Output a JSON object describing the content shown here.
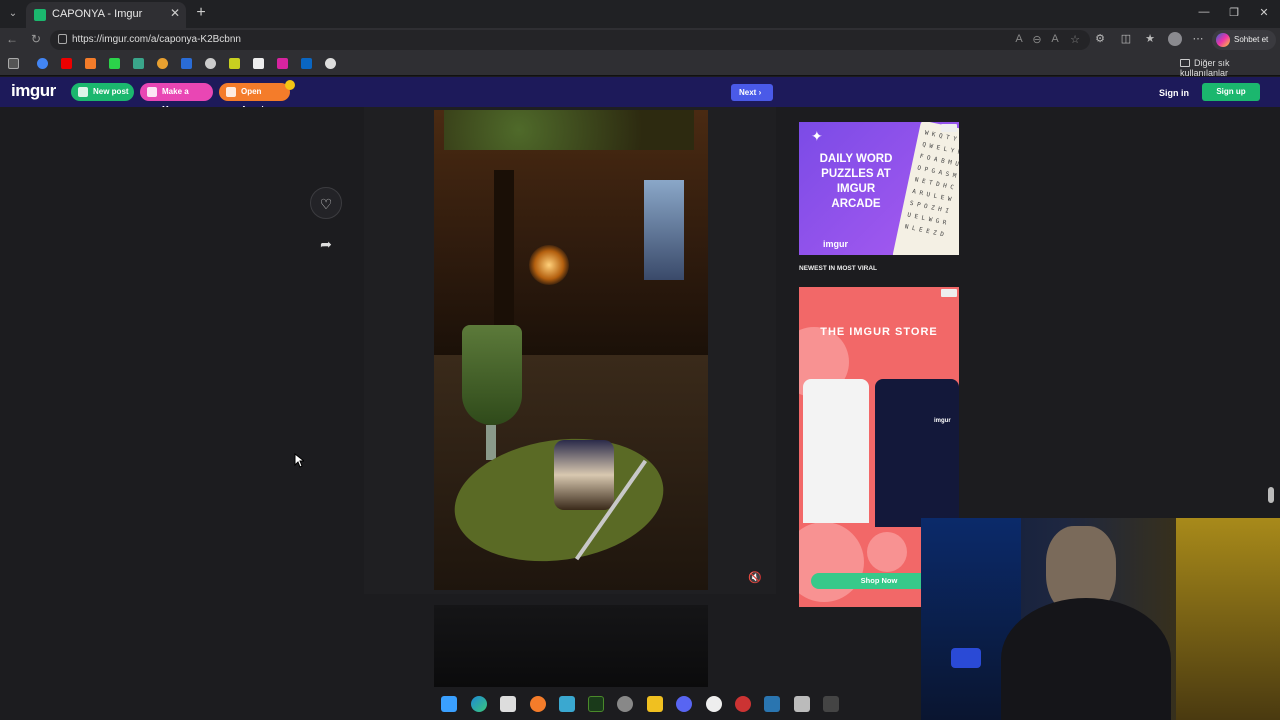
{
  "browser": {
    "tab_title": "CAPONYA - Imgur",
    "url": "https://imgur.com/a/caponya-K2Bcbnn",
    "copilot_label": "Sohbet et",
    "other_bookmarks": "Diğer sık kullanılanlar"
  },
  "header": {
    "logo": "imgur",
    "new_post": "New post",
    "make_meme": "Make a Meme",
    "open_arcade": "Open Arcade",
    "next": "Next",
    "sign_in": "Sign in",
    "sign_up": "Sign up"
  },
  "ads": {
    "arcade_text": "DAILY WORD PUZZLES AT IMGUR ARCADE",
    "arcade_brand": "imgur",
    "newest_label": "NEWEST IN MOST VIRAL",
    "store_title": "THE IMGUR STORE",
    "store_shirt_brand": "imgur",
    "shop_now": "Shop Now"
  },
  "colors": {
    "imgur_header": "#1d1a5a",
    "new_post": "#1bb76e",
    "make_meme": "#e946b4",
    "open_arcade": "#f47c2a",
    "next_button": "#4a5ae8",
    "sign_up": "#1bb76e"
  }
}
